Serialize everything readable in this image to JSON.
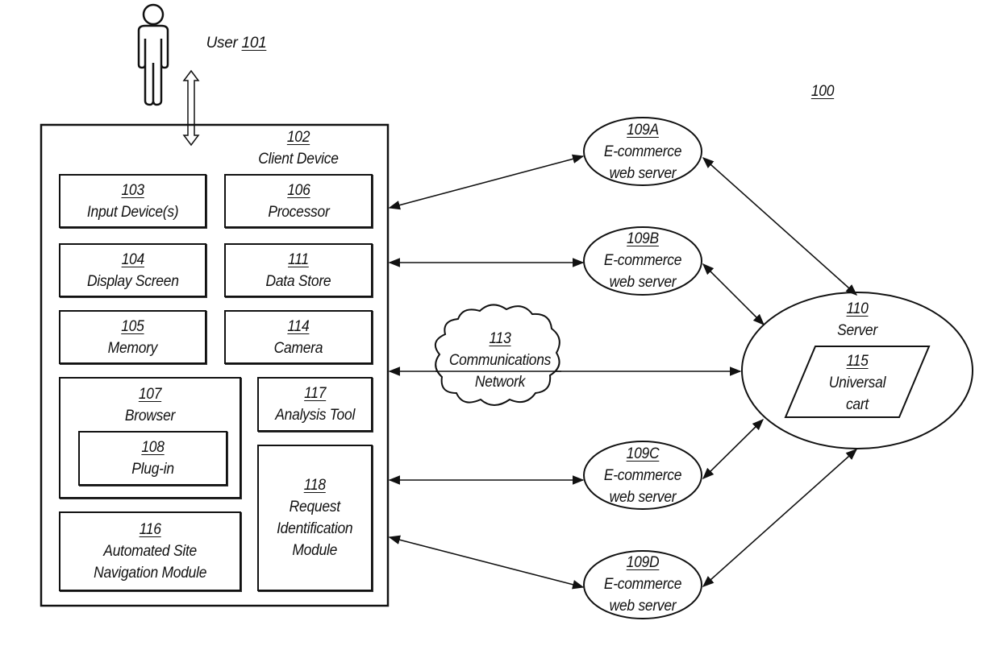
{
  "figure_number": "100",
  "user": {
    "label": "User",
    "ref": "101"
  },
  "client_device": {
    "ref": "102",
    "label": "Client Device"
  },
  "components": {
    "input": {
      "ref": "103",
      "label": "Input Device(s)"
    },
    "display": {
      "ref": "104",
      "label": "Display Screen"
    },
    "memory": {
      "ref": "105",
      "label": "Memory"
    },
    "processor": {
      "ref": "106",
      "label": "Processor"
    },
    "browser": {
      "ref": "107",
      "label": "Browser"
    },
    "plugin": {
      "ref": "108",
      "label": "Plug-in"
    },
    "data_store": {
      "ref": "111",
      "label": "Data Store"
    },
    "camera": {
      "ref": "114",
      "label": "Camera"
    },
    "asn_module": {
      "ref": "116",
      "label_line1": "Automated Site",
      "label_line2": "Navigation Module"
    },
    "analysis_tool": {
      "ref": "117",
      "label": "Analysis Tool"
    },
    "req_module": {
      "ref": "118",
      "label_line1": "Request",
      "label_line2": "Identification",
      "label_line3": "Module"
    }
  },
  "network": {
    "ref": "113",
    "label_line1": "Communications",
    "label_line2": "Network"
  },
  "ecommerce_servers": [
    {
      "ref": "109A",
      "label_line1": "E-commerce",
      "label_line2": "web server"
    },
    {
      "ref": "109B",
      "label_line1": "E-commerce",
      "label_line2": "web server"
    },
    {
      "ref": "109C",
      "label_line1": "E-commerce",
      "label_line2": "web server"
    },
    {
      "ref": "109D",
      "label_line1": "E-commerce",
      "label_line2": "web server"
    }
  ],
  "server": {
    "ref": "110",
    "label": "Server"
  },
  "universal_cart": {
    "ref": "115",
    "label_line1": "Universal",
    "label_line2": "cart"
  }
}
